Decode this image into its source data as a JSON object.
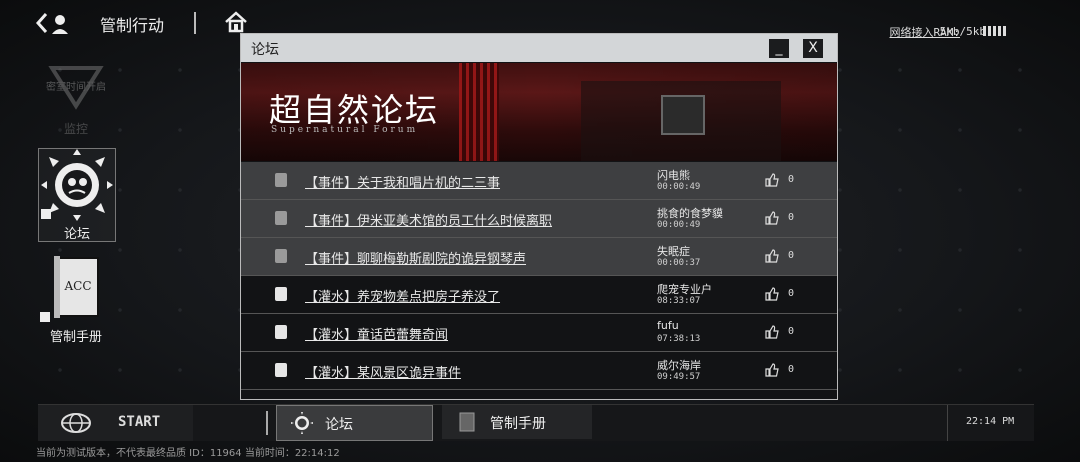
{
  "topbar": {
    "title": "管制行动",
    "network_label": "网络接入RAM:",
    "ram": "5kb/5kb"
  },
  "desktop": {
    "apps": [
      {
        "label_top": "密室时间开启",
        "label": "监控"
      },
      {
        "label": "论坛"
      },
      {
        "label": "管制手册",
        "book_text": "ACC"
      }
    ]
  },
  "window": {
    "title": "论坛",
    "minimize_label": "_",
    "close_label": "X",
    "banner_title": "超自然论坛",
    "banner_subtitle": "Supernatural Forum",
    "posts": [
      {
        "title": "【事件】关于我和唱片机的二三事",
        "author": "闪电熊",
        "time": "00:00:49",
        "likes": "0"
      },
      {
        "title": "【事件】伊米亚美术馆的员工什么时候离职",
        "author": "挑食的食梦貘",
        "time": "00:00:49",
        "likes": "0"
      },
      {
        "title": "【事件】聊聊梅勒斯剧院的诡异钢琴声",
        "author": "失眠症",
        "time": "00:00:37",
        "likes": "0"
      },
      {
        "title": "【灌水】养宠物差点把房子养没了",
        "author": "爬宠专业户",
        "time": "08:33:07",
        "likes": "0"
      },
      {
        "title": "【灌水】童话芭蕾舞奇闻",
        "author": "fufu",
        "time": "07:38:13",
        "likes": "0"
      },
      {
        "title": "【灌水】某风景区诡异事件",
        "author": "威尔海岸",
        "time": "09:49:57",
        "likes": "0"
      }
    ]
  },
  "taskbar": {
    "start_label": "START",
    "tasks": [
      {
        "label": "论坛"
      },
      {
        "label": "管制手册"
      }
    ],
    "clock": "22:14 PM"
  },
  "footer": "当前为测试版本，不代表最终品质 ID：11964 当前时间：22:14:12"
}
